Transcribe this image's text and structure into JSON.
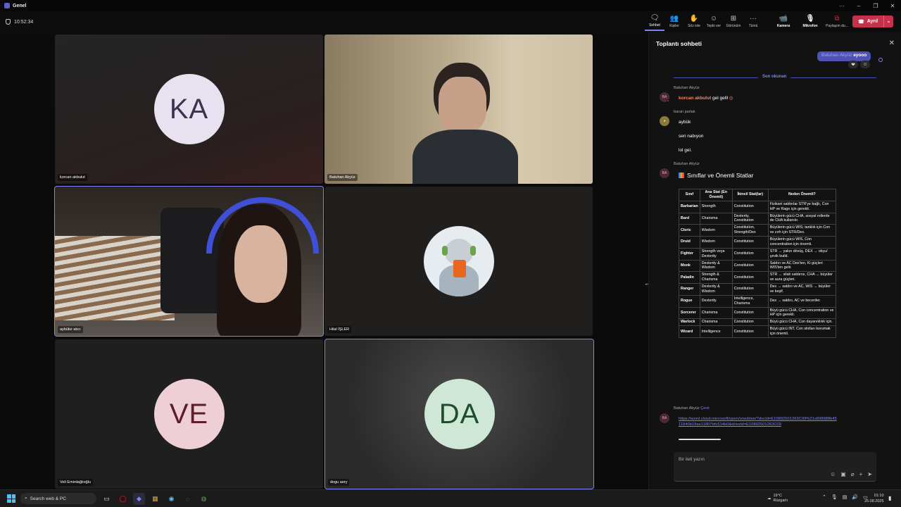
{
  "window": {
    "title": "Genel"
  },
  "meeting": {
    "timer": "10:52:34"
  },
  "toolbar": {
    "chat": "Sohbet",
    "people": "Kişiler",
    "people_count": "6",
    "raise": "Söz iste",
    "react": "Tepki ver",
    "view": "Görünüm",
    "more": "Tümü",
    "camera": "Kamera",
    "mic": "Mikrofon",
    "share": "Paylaşım du...",
    "leave": "Ayrıl"
  },
  "participants": [
    {
      "name": "korcan akbulut",
      "initials": "KA"
    },
    {
      "name": "Batuhan Akyüz",
      "initials": ""
    },
    {
      "name": "aybüke atıcı",
      "initials": ""
    },
    {
      "name": "Hilal İŞLER",
      "initials": ""
    },
    {
      "name": "Veli Emirdağlıoğlu",
      "initials": "VE"
    },
    {
      "name": "dogu aery",
      "initials": "DA"
    }
  ],
  "chat": {
    "title": "Toplantı sohbeti",
    "sent_preview_name": "Batuhan Akyüz",
    "sent_preview_text": "eyooo",
    "last_read": "Son okunan",
    "messages": [
      {
        "sender": "Batuhan Akyüz",
        "avatar": "BA",
        "mention": "korcan akbulut",
        "text": "gel gelll"
      },
      {
        "sender": "baran parlak",
        "lines": [
          "aybük",
          "sen nabıyon",
          "lol gel."
        ]
      },
      {
        "sender": "Batuhan Akyüz",
        "avatar": "BA"
      },
      {
        "sender": "Batuhan Akyüz",
        "translate": "Çevir",
        "avatar": "BA",
        "link": "https://word.cloud.microsoft/open/onedrive/?docId=E10892501263C09%21s898988b4511840b19ae11807bfc514b0&driveId=E10892501263C09"
      }
    ],
    "card_title": "Sınıflar ve Önemli Statlar",
    "table": {
      "headers": [
        "Sınıf",
        "Ana Stat (En Önemli)",
        "İkincil Stat(lar)",
        "Neden Önemli?"
      ],
      "rows": [
        [
          "Barbarian",
          "Strength",
          "Constitution",
          "Fiziksel saldırılar STR'ye bağlı, Con HP ve Rage için gerekli."
        ],
        [
          "Bard",
          "Charisma",
          "Dexterity, Constitution",
          "Büyülerin gücü CHA, sosyal rollerde de CHA kullanılır."
        ],
        [
          "Cleric",
          "Wisdom",
          "Constitution, Strength/Dex",
          "Büyülerin gücü WIS; tanklık için Con ve zırh için STR/Dex."
        ],
        [
          "Druid",
          "Wisdom",
          "Constitution",
          "Büyülerin gücü WIS, Con concentration için önemli."
        ],
        [
          "Fighter",
          "Strength veya Dexterity",
          "Constitution",
          "STR → yakın dövüş, DEX → okçu/çevik build."
        ],
        [
          "Monk",
          "Dexterity & Wisdom",
          "Constitution",
          "Saldırı ve AC Dex'ten, Ki güçleri WIS'ten gelir."
        ],
        [
          "Paladin",
          "Strength & Charisma",
          "Constitution",
          "STR → silah saldırısı, CHA → büyüler ve aura güçleri."
        ],
        [
          "Ranger",
          "Dexterity & Wisdom",
          "Constitution",
          "Dex → saldırı ve AC, WIS → büyüler ve keşif."
        ],
        [
          "Rogue",
          "Dexterity",
          "Intelligence, Charisma",
          "Dex → saldırı, AC ve beceriler."
        ],
        [
          "Sorcerer",
          "Charisma",
          "Constitution",
          "Büyü gücü CHA, Con concentration ve HP için gerekli."
        ],
        [
          "Warlock",
          "Charisma",
          "Constitution",
          "Büyü gücü CHA, Con dayanıklılık için."
        ],
        [
          "Wizard",
          "Intelligence",
          "Constitution",
          "Büyü gücü INT, Con slotları korumak için önemli."
        ]
      ]
    },
    "compose_placeholder": "Bir ileti yazın"
  },
  "taskbar": {
    "search": "Search web & PC",
    "temp": "19°C",
    "weather": "Rüzgarlı",
    "time": "01:10",
    "date": "25.08.2025"
  }
}
